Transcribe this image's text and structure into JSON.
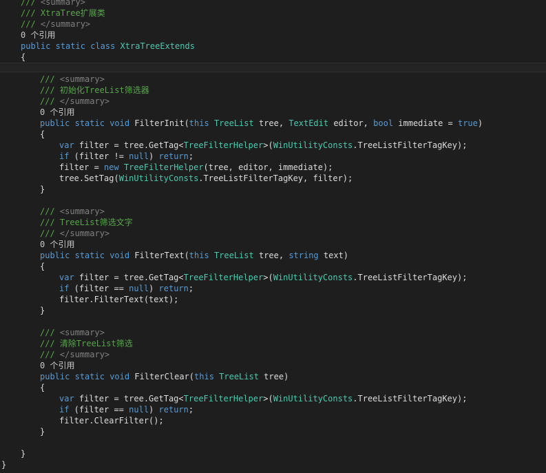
{
  "editor": {
    "lines": [
      {
        "indent": 4,
        "segments": [
          {
            "t": "/// ",
            "c": "cm"
          },
          {
            "t": "<summary>",
            "c": "xd"
          }
        ]
      },
      {
        "indent": 4,
        "segments": [
          {
            "t": "/// XtraTree扩展类",
            "c": "cm"
          }
        ]
      },
      {
        "indent": 4,
        "segments": [
          {
            "t": "/// ",
            "c": "cm"
          },
          {
            "t": "</summary>",
            "c": "xd"
          }
        ]
      },
      {
        "indent": 4,
        "segments": [
          {
            "t": "0 个引用",
            "c": "cl"
          }
        ],
        "codelens": true
      },
      {
        "indent": 4,
        "segments": [
          {
            "t": "public",
            "c": "kw"
          },
          {
            "t": " ",
            "c": "tx"
          },
          {
            "t": "static",
            "c": "kw"
          },
          {
            "t": " ",
            "c": "tx"
          },
          {
            "t": "class",
            "c": "kw"
          },
          {
            "t": " ",
            "c": "tx"
          },
          {
            "t": "XtraTreeExtends",
            "c": "ty"
          }
        ]
      },
      {
        "indent": 4,
        "segments": [
          {
            "t": "{",
            "c": "tx"
          }
        ]
      },
      {
        "indent": 0,
        "segments": [],
        "current": true
      },
      {
        "indent": 8,
        "segments": [
          {
            "t": "/// ",
            "c": "cm"
          },
          {
            "t": "<summary>",
            "c": "xd"
          }
        ]
      },
      {
        "indent": 8,
        "segments": [
          {
            "t": "/// 初始化TreeList筛选器",
            "c": "cm"
          }
        ]
      },
      {
        "indent": 8,
        "segments": [
          {
            "t": "/// ",
            "c": "cm"
          },
          {
            "t": "</summary>",
            "c": "xd"
          }
        ]
      },
      {
        "indent": 8,
        "segments": [
          {
            "t": "0 个引用",
            "c": "cl"
          }
        ],
        "codelens": true
      },
      {
        "indent": 8,
        "segments": [
          {
            "t": "public",
            "c": "kw"
          },
          {
            "t": " ",
            "c": "tx"
          },
          {
            "t": "static",
            "c": "kw"
          },
          {
            "t": " ",
            "c": "tx"
          },
          {
            "t": "void",
            "c": "kw"
          },
          {
            "t": " FilterInit(",
            "c": "tx"
          },
          {
            "t": "this",
            "c": "kw"
          },
          {
            "t": " ",
            "c": "tx"
          },
          {
            "t": "TreeList",
            "c": "ty"
          },
          {
            "t": " tree, ",
            "c": "tx"
          },
          {
            "t": "TextEdit",
            "c": "ty"
          },
          {
            "t": " editor, ",
            "c": "tx"
          },
          {
            "t": "bool",
            "c": "kw"
          },
          {
            "t": " immediate = ",
            "c": "tx"
          },
          {
            "t": "true",
            "c": "kw"
          },
          {
            "t": ")",
            "c": "tx"
          }
        ]
      },
      {
        "indent": 8,
        "segments": [
          {
            "t": "{",
            "c": "tx"
          }
        ]
      },
      {
        "indent": 12,
        "segments": [
          {
            "t": "var",
            "c": "kw"
          },
          {
            "t": " filter = tree.GetTag<",
            "c": "tx"
          },
          {
            "t": "TreeFilterHelper",
            "c": "ty"
          },
          {
            "t": ">(",
            "c": "tx"
          },
          {
            "t": "WinUtilityConsts",
            "c": "ty"
          },
          {
            "t": ".TreeListFilterTagKey);",
            "c": "tx"
          }
        ]
      },
      {
        "indent": 12,
        "segments": [
          {
            "t": "if",
            "c": "kw"
          },
          {
            "t": " (filter != ",
            "c": "tx"
          },
          {
            "t": "null",
            "c": "kw"
          },
          {
            "t": ") ",
            "c": "tx"
          },
          {
            "t": "return",
            "c": "kw"
          },
          {
            "t": ";",
            "c": "tx"
          }
        ]
      },
      {
        "indent": 12,
        "segments": [
          {
            "t": "filter = ",
            "c": "tx"
          },
          {
            "t": "new",
            "c": "kw"
          },
          {
            "t": " ",
            "c": "tx"
          },
          {
            "t": "TreeFilterHelper",
            "c": "ty"
          },
          {
            "t": "(tree, editor, immediate);",
            "c": "tx"
          }
        ]
      },
      {
        "indent": 12,
        "segments": [
          {
            "t": "tree.SetTag(",
            "c": "tx"
          },
          {
            "t": "WinUtilityConsts",
            "c": "ty"
          },
          {
            "t": ".TreeListFilterTagKey, filter);",
            "c": "tx"
          }
        ]
      },
      {
        "indent": 8,
        "segments": [
          {
            "t": "}",
            "c": "tx"
          }
        ]
      },
      {
        "indent": 0,
        "segments": []
      },
      {
        "indent": 8,
        "segments": [
          {
            "t": "/// ",
            "c": "cm"
          },
          {
            "t": "<summary>",
            "c": "xd"
          }
        ]
      },
      {
        "indent": 8,
        "segments": [
          {
            "t": "/// TreeList筛选文字",
            "c": "cm"
          }
        ]
      },
      {
        "indent": 8,
        "segments": [
          {
            "t": "/// ",
            "c": "cm"
          },
          {
            "t": "</summary>",
            "c": "xd"
          }
        ]
      },
      {
        "indent": 8,
        "segments": [
          {
            "t": "0 个引用",
            "c": "cl"
          }
        ],
        "codelens": true
      },
      {
        "indent": 8,
        "segments": [
          {
            "t": "public",
            "c": "kw"
          },
          {
            "t": " ",
            "c": "tx"
          },
          {
            "t": "static",
            "c": "kw"
          },
          {
            "t": " ",
            "c": "tx"
          },
          {
            "t": "void",
            "c": "kw"
          },
          {
            "t": " FilterText(",
            "c": "tx"
          },
          {
            "t": "this",
            "c": "kw"
          },
          {
            "t": " ",
            "c": "tx"
          },
          {
            "t": "TreeList",
            "c": "ty"
          },
          {
            "t": " tree, ",
            "c": "tx"
          },
          {
            "t": "string",
            "c": "kw"
          },
          {
            "t": " text)",
            "c": "tx"
          }
        ]
      },
      {
        "indent": 8,
        "segments": [
          {
            "t": "{",
            "c": "tx"
          }
        ]
      },
      {
        "indent": 12,
        "segments": [
          {
            "t": "var",
            "c": "kw"
          },
          {
            "t": " filter = tree.GetTag<",
            "c": "tx"
          },
          {
            "t": "TreeFilterHelper",
            "c": "ty"
          },
          {
            "t": ">(",
            "c": "tx"
          },
          {
            "t": "WinUtilityConsts",
            "c": "ty"
          },
          {
            "t": ".TreeListFilterTagKey);",
            "c": "tx"
          }
        ]
      },
      {
        "indent": 12,
        "segments": [
          {
            "t": "if",
            "c": "kw"
          },
          {
            "t": " (filter == ",
            "c": "tx"
          },
          {
            "t": "null",
            "c": "kw"
          },
          {
            "t": ") ",
            "c": "tx"
          },
          {
            "t": "return",
            "c": "kw"
          },
          {
            "t": ";",
            "c": "tx"
          }
        ]
      },
      {
        "indent": 12,
        "segments": [
          {
            "t": "filter.FilterText(text);",
            "c": "tx"
          }
        ]
      },
      {
        "indent": 8,
        "segments": [
          {
            "t": "}",
            "c": "tx"
          }
        ]
      },
      {
        "indent": 0,
        "segments": []
      },
      {
        "indent": 8,
        "segments": [
          {
            "t": "/// ",
            "c": "cm"
          },
          {
            "t": "<summary>",
            "c": "xd"
          }
        ]
      },
      {
        "indent": 8,
        "segments": [
          {
            "t": "/// 清除TreeList筛选",
            "c": "cm"
          }
        ]
      },
      {
        "indent": 8,
        "segments": [
          {
            "t": "/// ",
            "c": "cm"
          },
          {
            "t": "</summary>",
            "c": "xd"
          }
        ]
      },
      {
        "indent": 8,
        "segments": [
          {
            "t": "0 个引用",
            "c": "cl"
          }
        ],
        "codelens": true
      },
      {
        "indent": 8,
        "segments": [
          {
            "t": "public",
            "c": "kw"
          },
          {
            "t": " ",
            "c": "tx"
          },
          {
            "t": "static",
            "c": "kw"
          },
          {
            "t": " ",
            "c": "tx"
          },
          {
            "t": "void",
            "c": "kw"
          },
          {
            "t": " FilterClear(",
            "c": "tx"
          },
          {
            "t": "this",
            "c": "kw"
          },
          {
            "t": " ",
            "c": "tx"
          },
          {
            "t": "TreeList",
            "c": "ty"
          },
          {
            "t": " tree)",
            "c": "tx"
          }
        ]
      },
      {
        "indent": 8,
        "segments": [
          {
            "t": "{",
            "c": "tx"
          }
        ]
      },
      {
        "indent": 12,
        "segments": [
          {
            "t": "var",
            "c": "kw"
          },
          {
            "t": " filter = tree.GetTag<",
            "c": "tx"
          },
          {
            "t": "TreeFilterHelper",
            "c": "ty"
          },
          {
            "t": ">(",
            "c": "tx"
          },
          {
            "t": "WinUtilityConsts",
            "c": "ty"
          },
          {
            "t": ".TreeListFilterTagKey);",
            "c": "tx"
          }
        ]
      },
      {
        "indent": 12,
        "segments": [
          {
            "t": "if",
            "c": "kw"
          },
          {
            "t": " (filter == ",
            "c": "tx"
          },
          {
            "t": "null",
            "c": "kw"
          },
          {
            "t": ") ",
            "c": "tx"
          },
          {
            "t": "return",
            "c": "kw"
          },
          {
            "t": ";",
            "c": "tx"
          }
        ]
      },
      {
        "indent": 12,
        "segments": [
          {
            "t": "filter.ClearFilter();",
            "c": "tx"
          }
        ]
      },
      {
        "indent": 8,
        "segments": [
          {
            "t": "}",
            "c": "tx"
          }
        ]
      },
      {
        "indent": 0,
        "segments": []
      },
      {
        "indent": 4,
        "segments": [
          {
            "t": "}",
            "c": "tx"
          }
        ]
      },
      {
        "indent": 0,
        "segments": [
          {
            "t": "}",
            "c": "tx"
          }
        ]
      }
    ],
    "colors": {
      "background": "#1e1e1e",
      "keyword": "#569cd6",
      "type": "#4ec9b0",
      "comment": "#57a64a",
      "xml_doc_tag": "#808080",
      "text": "#dcdcdc",
      "codelens": "#c8c8c8"
    }
  }
}
